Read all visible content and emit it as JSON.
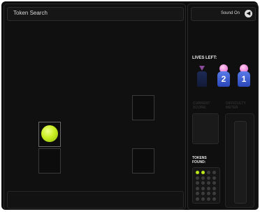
{
  "game": {
    "title": "Token Search"
  },
  "sound": {
    "label": "Sound On",
    "icon": "speaker-icon"
  },
  "lives": {
    "label": "LIVES LEFT:",
    "total": 3,
    "remaining": 2,
    "badges": [
      "",
      "2",
      "1"
    ]
  },
  "score": {
    "label_line1": "CURRENT",
    "label_line2": "SCORE:"
  },
  "difficulty": {
    "label_line1": "DIFFICULTY",
    "label_line2": "METER"
  },
  "tokens": {
    "label_line1": "TOKENS",
    "label_line2": "FOUND:",
    "found": 2,
    "total": 24,
    "colors": {
      "found": "#b8e61a",
      "empty": "#3c3c3c"
    }
  },
  "colors": {
    "token": "#c8ee22",
    "background": "#0d0d0d"
  }
}
